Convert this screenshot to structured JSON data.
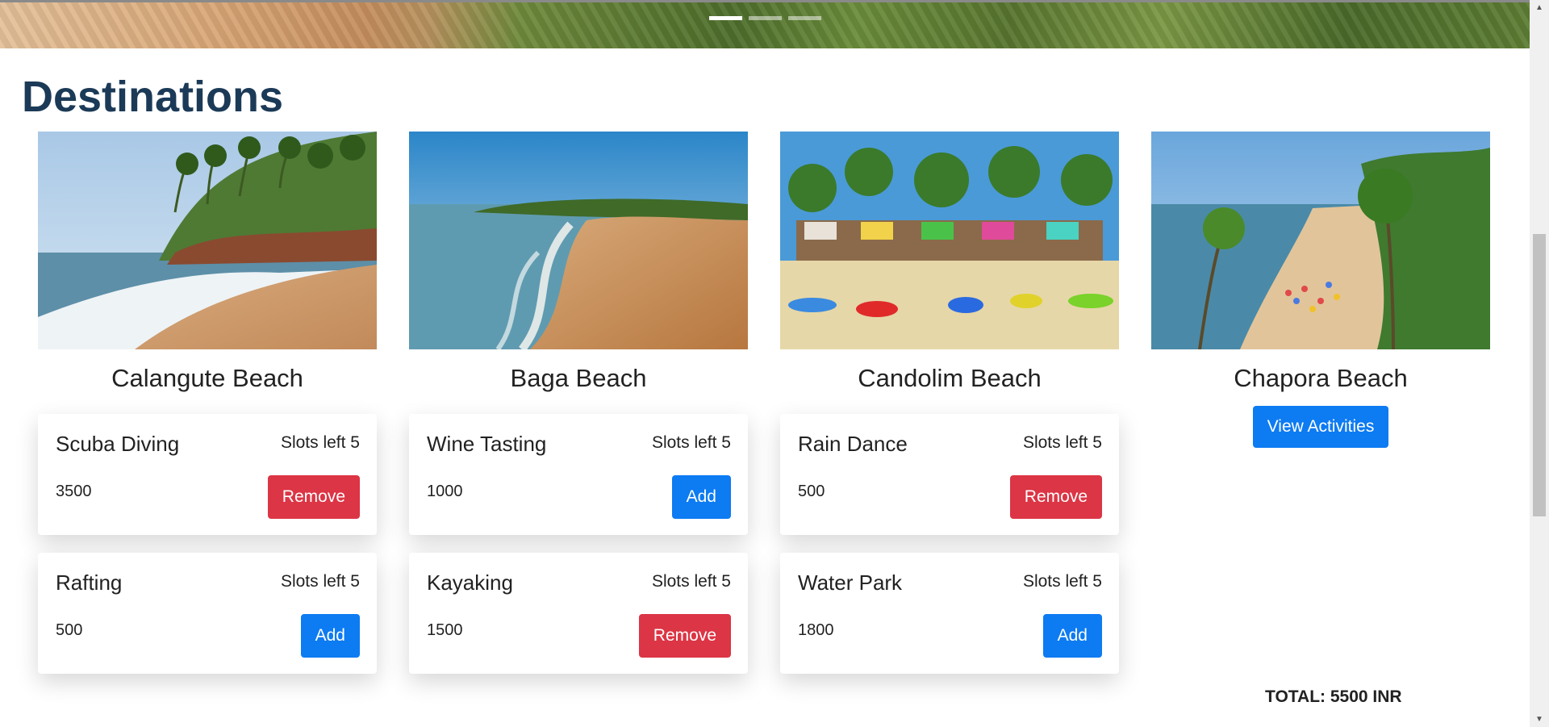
{
  "hero": {
    "slides": 3,
    "active_slide": 1
  },
  "section_title": "Destinations",
  "destinations": [
    {
      "name": "Calangute Beach",
      "activities": [
        {
          "name": "Scuba Diving",
          "slots": "Slots left 5",
          "price": "3500",
          "action": "Remove"
        },
        {
          "name": "Rafting",
          "slots": "Slots left 5",
          "price": "500",
          "action": "Add"
        }
      ]
    },
    {
      "name": "Baga Beach",
      "activities": [
        {
          "name": "Wine Tasting",
          "slots": "Slots left 5",
          "price": "1000",
          "action": "Add"
        },
        {
          "name": "Kayaking",
          "slots": "Slots left 5",
          "price": "1500",
          "action": "Remove"
        }
      ]
    },
    {
      "name": "Candolim Beach",
      "activities": [
        {
          "name": "Rain Dance",
          "slots": "Slots left 5",
          "price": "500",
          "action": "Remove"
        },
        {
          "name": "Water Park",
          "slots": "Slots left 5",
          "price": "1800",
          "action": "Add"
        }
      ]
    },
    {
      "name": "Chapora Beach",
      "view_button": "View Activities",
      "activities": []
    }
  ],
  "total_label": "TOTAL: 5500 INR",
  "colors": {
    "title": "#1b3a57",
    "add": "#0d7bf2",
    "remove": "#dc3545"
  }
}
